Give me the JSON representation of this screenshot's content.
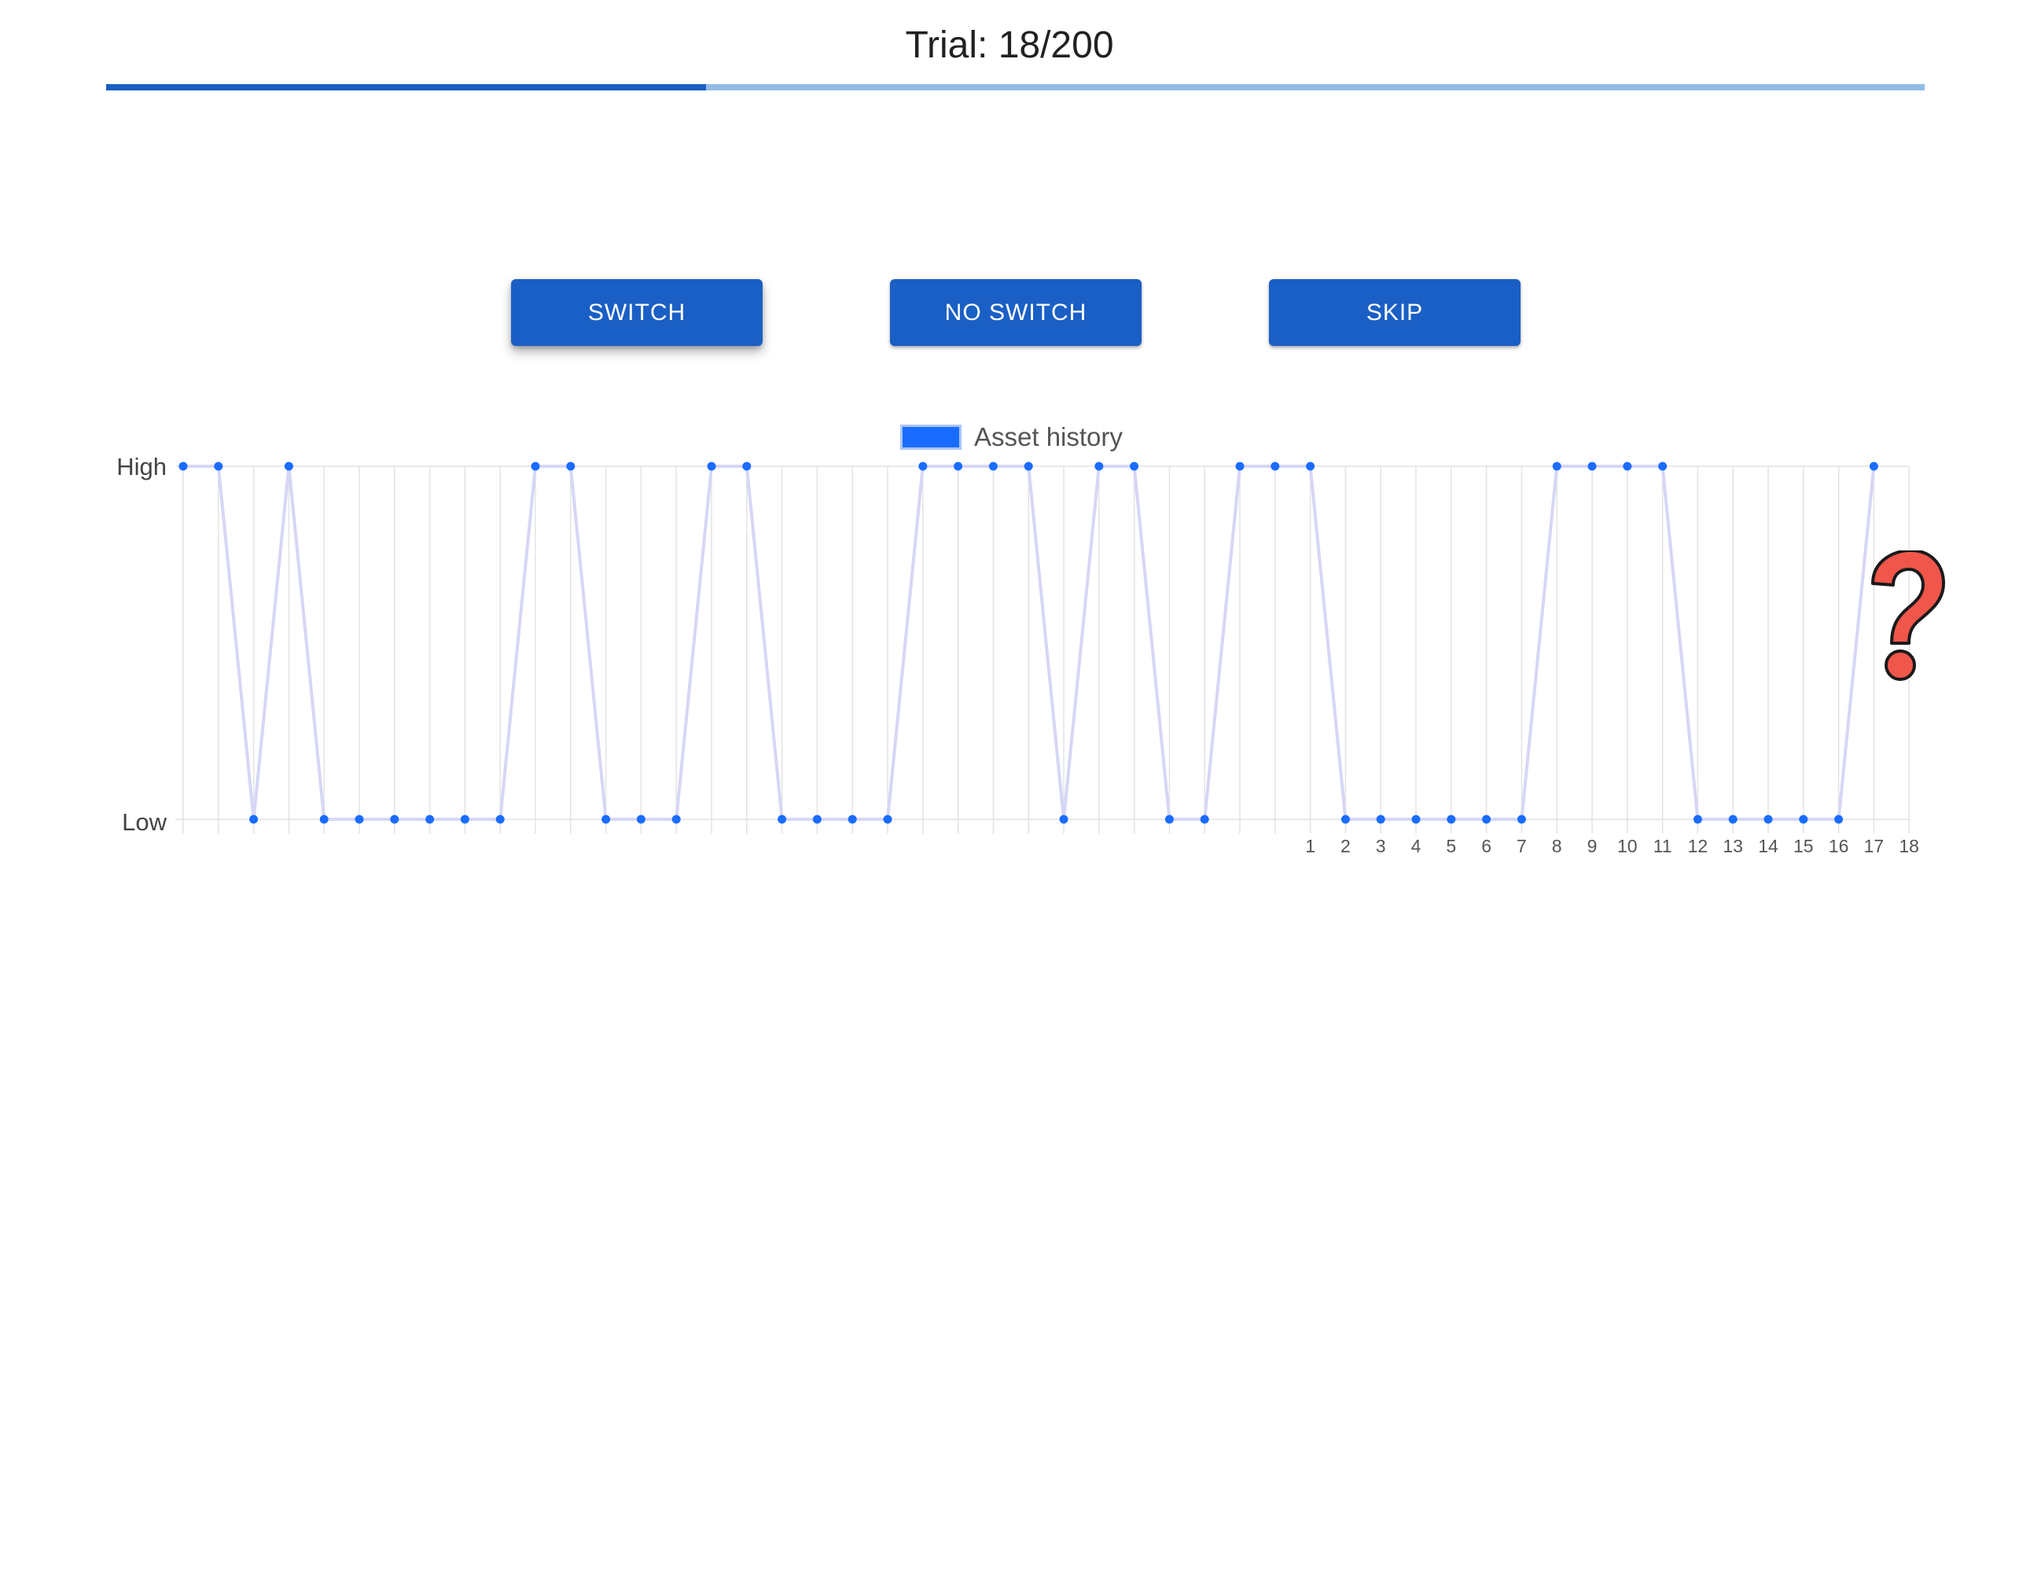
{
  "header": {
    "trial_label": "Trial: 18/200",
    "progress": {
      "current": 18,
      "total": 200,
      "fill_fraction": 0.33
    }
  },
  "buttons": {
    "switch_label": "SWITCH",
    "no_switch_label": "NO SWITCH",
    "skip_label": "SKIP"
  },
  "chart_data": {
    "type": "line",
    "legend": [
      "Asset history"
    ],
    "ytick_labels": [
      "Low",
      "High"
    ],
    "x_tick_labels_shown": [
      "1",
      "2",
      "3",
      "4",
      "5",
      "6",
      "7",
      "8",
      "9",
      "10",
      "11",
      "12",
      "13",
      "14",
      "15",
      "16",
      "17",
      "18"
    ],
    "series": [
      {
        "name": "Asset history",
        "values": [
          1,
          1,
          0,
          1,
          0,
          0,
          0,
          0,
          0,
          0,
          1,
          1,
          0,
          0,
          0,
          1,
          1,
          0,
          0,
          0,
          0,
          1,
          1,
          1,
          1,
          0,
          1,
          1,
          0,
          0,
          1,
          1,
          1,
          0,
          0,
          0,
          0,
          0,
          0,
          1,
          1,
          1,
          1,
          0,
          0,
          0,
          0,
          0,
          1
        ]
      }
    ],
    "ylim": [
      0,
      1
    ],
    "grid": true,
    "legend_position": "top-center",
    "colors": {
      "point": "#1a6cff",
      "line": "#d6d6f5",
      "grid": "#e3e3e3",
      "legend_swatch": "#1a6cff"
    }
  },
  "overlay": {
    "icon": "question-mark-icon",
    "color": "#f0564a"
  },
  "colors": {
    "primary": "#1a5fc5",
    "progress_track": "#90bde6"
  }
}
